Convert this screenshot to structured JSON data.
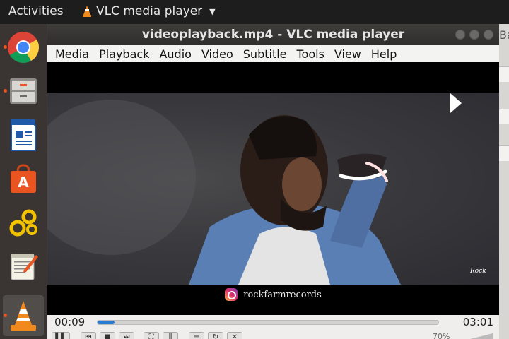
{
  "topbar": {
    "activities": "Activities",
    "app_name": "VLC media player"
  },
  "dock": {
    "items": [
      {
        "name": "chrome",
        "running": true
      },
      {
        "name": "files",
        "running": true
      },
      {
        "name": "writer",
        "running": false
      },
      {
        "name": "software",
        "running": false
      },
      {
        "name": "settings",
        "running": false
      },
      {
        "name": "text-editor",
        "running": false
      },
      {
        "name": "vlc",
        "running": true
      }
    ]
  },
  "window": {
    "title": "videoplayback.mp4 - VLC media player",
    "menu": [
      "Media",
      "Playback",
      "Audio",
      "Video",
      "Subtitle",
      "Tools",
      "View",
      "Help"
    ]
  },
  "video": {
    "watermark": "rockfarmrecords"
  },
  "controls": {
    "elapsed": "00:09",
    "total": "03:01",
    "progress_fraction": 0.05,
    "volume": "70%"
  },
  "background_window": {
    "text": "Ba"
  }
}
